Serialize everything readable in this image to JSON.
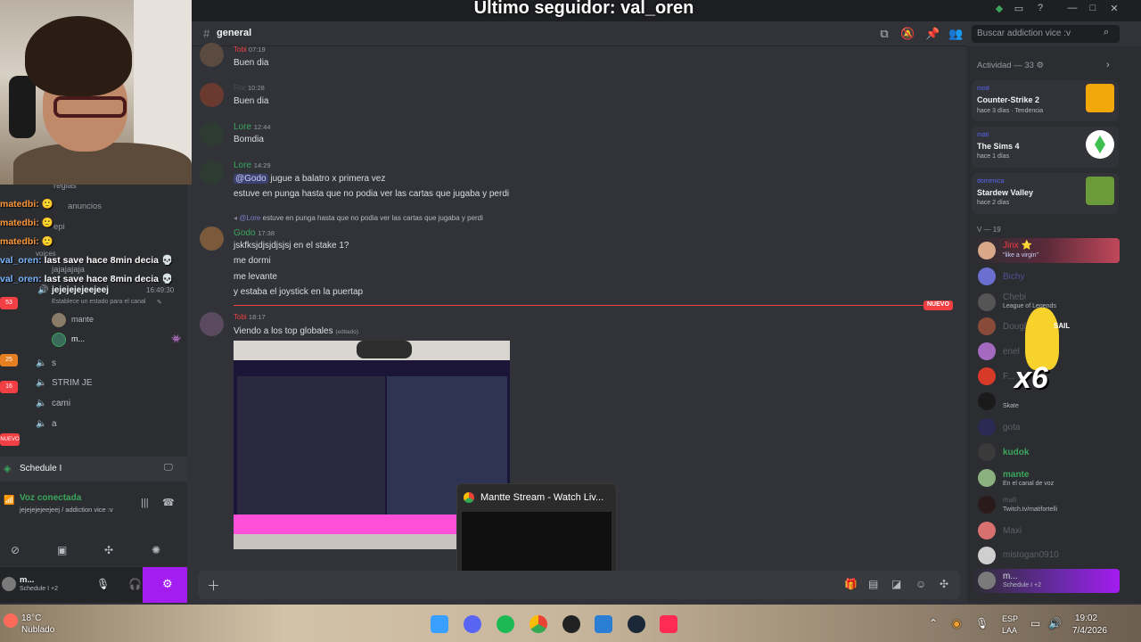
{
  "overlay": {
    "follower_text": "Último seguidor: val_oren"
  },
  "channel": {
    "name": "general",
    "search_placeholder": "Buscar addiction vice :v"
  },
  "left_chat": [
    {
      "user": "matedbi:",
      "msg": ""
    },
    {
      "user": "matedbi:",
      "msg": ""
    },
    {
      "user": "matedbi:",
      "msg": ""
    },
    {
      "user": "val_oren:",
      "msg": "last save hace 8min decia"
    },
    {
      "user": "val_oren:",
      "msg": "last save hace 8min decia"
    }
  ],
  "sidebar": {
    "faded_channels": [
      "reglas",
      "anuncios",
      "epi",
      "jajajajaja",
      "voices"
    ],
    "voice_user_status": "jejejejejeejeej",
    "voice_time": "16:49:30",
    "voice_note": "Establece un estado para el canal",
    "voice_members": [
      "mante",
      "m..."
    ],
    "voice_channels": [
      "s",
      "STRIM JE",
      "cami",
      "a"
    ],
    "badges": [
      "53",
      "25",
      "16",
      "NUEVO"
    ],
    "schedule": "Schedule I",
    "voice_connected": "Voz conectada",
    "voice_connected_detail": "jejejejejeejeej / addiction vice :v",
    "user_name": "m...",
    "user_status": "Schedule I +2"
  },
  "messages": [
    {
      "name": "Tobi",
      "time": "07:19",
      "text": "Buen dia"
    },
    {
      "name": "Fior",
      "time": "10:28",
      "text": "Buen dia"
    },
    {
      "name": "Lore",
      "time": "12:44",
      "text": "Bomdia"
    },
    {
      "name": "Lore",
      "time": "14:29",
      "mention": "@Godo",
      "text": " jugue a balatro x primera vez",
      "text2": "estuve en punga hasta que no podia ver las cartas que jugaba y perdi"
    },
    {
      "reply_to": "@Lore",
      "reply_text": "estuve en punga hasta que no podia ver las cartas que jugaba y perdi",
      "name": "Godo",
      "time": "17:38",
      "lines": [
        "jskfksjdjsjdjsjsj en el stake 1?",
        "me dormi",
        "me levante",
        "y estaba el joystick en la puertap"
      ]
    },
    {
      "name": "Tobi",
      "time": "18:17",
      "text": "Viendo a los top globales",
      "edited": "(editado)"
    }
  ],
  "new_marker": "NUEVO",
  "preview": {
    "title": "Mantte Stream - Watch Liv..."
  },
  "members": {
    "activity_title": "Actividad — 33",
    "activities": [
      {
        "user": "mod",
        "game": "Counter-Strike 2",
        "meta": "hace 3 días · Tendencia",
        "color": "#f4a70b"
      },
      {
        "user": "mati",
        "game": "The Sims 4",
        "meta": "hace 1 días",
        "color": "#3fbf4f"
      },
      {
        "user": "domenica",
        "game": "Stardew Valley",
        "meta": "hace 2 días",
        "color": "#6a9a3a"
      }
    ],
    "v_header": "V — 19",
    "list": [
      {
        "name": "Jinx ⭐",
        "sub": "\"like a virgin\"",
        "color": "#f23f43"
      },
      {
        "name": "Bichy",
        "sub": "",
        "color": "#6a6fd0"
      },
      {
        "name": "Chebi",
        "sub": "League of Legends",
        "color": "#6b6b6b"
      },
      {
        "name": "Douglas",
        "sub": "",
        "color": "#6b6b6b"
      },
      {
        "name": "enel",
        "sub": "",
        "color": "#6b6b6b"
      },
      {
        "name": "F...",
        "sub": "",
        "color": "#6b6b6b"
      },
      {
        "name": "",
        "sub": "Skate",
        "color": "#6b6b6b"
      },
      {
        "name": "gota",
        "sub": "",
        "color": "#6b6b6b"
      },
      {
        "name": "kudok",
        "sub": "",
        "color": "#3ba55d"
      },
      {
        "name": "mante",
        "sub": "En el canal de voz",
        "color": "#3ba55d"
      },
      {
        "name": "mati",
        "sub": "Twitch.tv/matifortelli",
        "color": "#6b6b6b"
      },
      {
        "name": "Maxi",
        "sub": "",
        "color": "#6b6b6b"
      },
      {
        "name": "mistogan0910",
        "sub": "",
        "color": "#6b6b6b"
      },
      {
        "name": "m...",
        "sub": "Schedule I +2",
        "color": "#dbdee1"
      }
    ],
    "emote_sail": "SAIL",
    "emote_x6": "x6"
  },
  "taskbar": {
    "temp": "18°C",
    "weather": "Nublado",
    "lang1": "ESP",
    "lang2": "LAA",
    "time": "19:02",
    "date": "7/4/2026",
    "apps": [
      "windows",
      "discord",
      "spotify",
      "chrome",
      "obs",
      "photos",
      "steam",
      "tiktok"
    ]
  },
  "colors": {
    "accent": "#5865f2",
    "alert": "#f23f43",
    "brand_purple": "#a31cf0"
  }
}
